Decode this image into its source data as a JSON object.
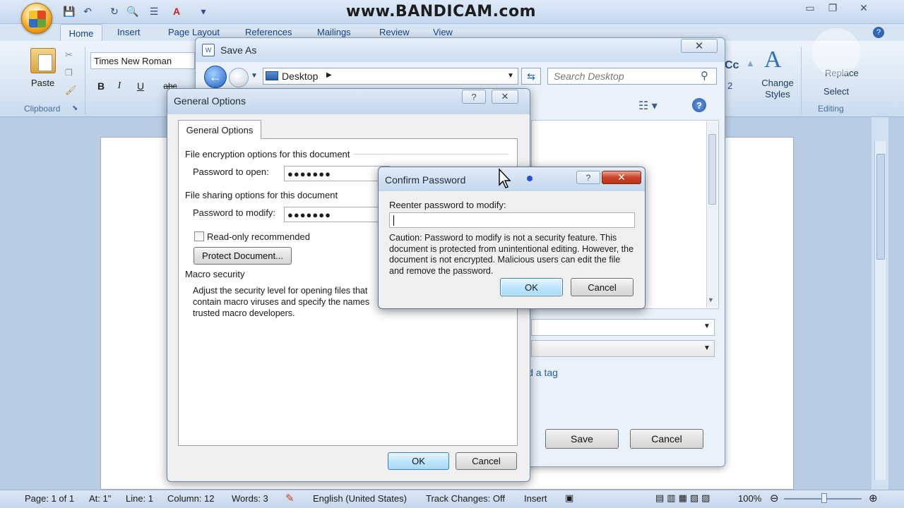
{
  "watermark": "www.BANDICAM.com",
  "ribbon": {
    "tabs": [
      "Home",
      "Insert",
      "Page Layout",
      "References",
      "Mailings",
      "Review",
      "View"
    ],
    "font_name": "Times New Roman",
    "paste_label": "Paste",
    "clipboard_label": "Clipboard",
    "change_styles_label": "Change Styles",
    "replace_label": "Replace",
    "select_label": "Select",
    "editing_label": "Editing",
    "cc_label": "Cc",
    "num2": "2"
  },
  "save_as": {
    "title": "Save As",
    "address": "Desktop",
    "search_placeholder": "Search Desktop",
    "add_tag": "ld a tag",
    "save_label": "Save",
    "cancel_label": "Cancel"
  },
  "general_options": {
    "title": "General Options",
    "tab": "General Options",
    "encryption_heading": "File encryption options for this document",
    "password_open_label": "Password to open:",
    "password_open_value": "●●●●●●●",
    "sharing_heading": "File sharing options for this document",
    "password_modify_label": "Password to modify:",
    "password_modify_value": "●●●●●●●",
    "readonly_label": "Read-only recommended",
    "protect_button": "Protect Document...",
    "macro_heading": "Macro security",
    "macro_text_1": "Adjust the security level for opening files that",
    "macro_text_2": "contain macro viruses and specify the names",
    "macro_text_3": "trusted macro developers.",
    "ok_label": "OK",
    "cancel_label": "Cancel"
  },
  "confirm_password": {
    "title": "Confirm Password",
    "prompt": "Reenter password to modify:",
    "caution": "Caution: Password to modify is not a security feature. This document is protected from unintentional editing. However, the document is not encrypted. Malicious users can edit the file and remove the password.",
    "ok_label": "OK",
    "cancel_label": "Cancel"
  },
  "status_bar": {
    "page": "Page: 1 of 1",
    "at": "At: 1\"",
    "line": "Line: 1",
    "column": "Column: 12",
    "words": "Words: 3",
    "language": "English (United States)",
    "track_changes": "Track Changes: Off",
    "mode": "Insert",
    "zoom": "100%"
  }
}
